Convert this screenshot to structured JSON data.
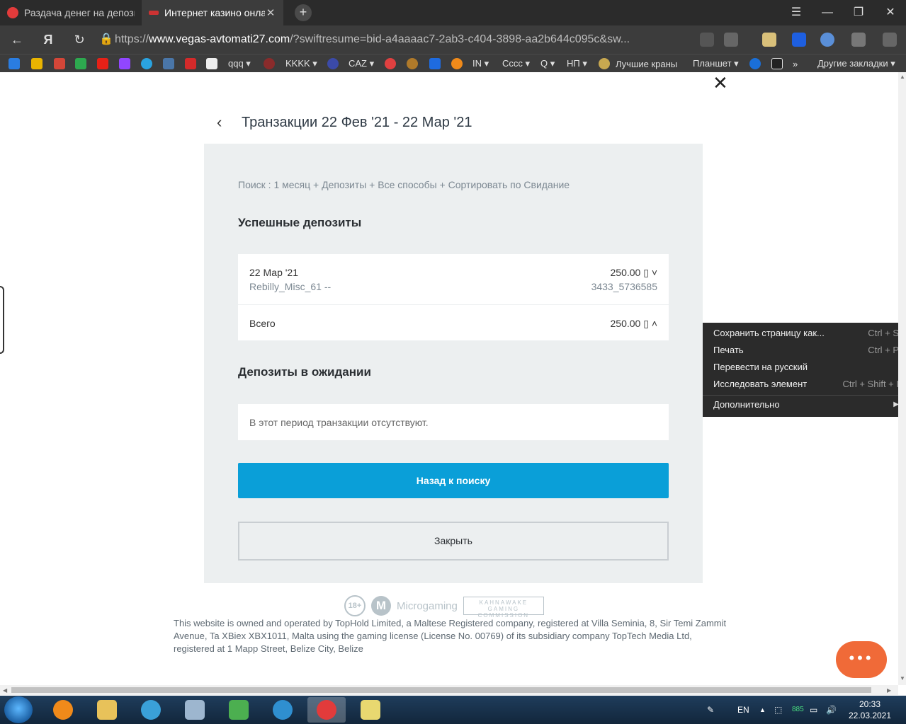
{
  "browser": {
    "tabs": [
      {
        "title": "Раздача денег на депозит",
        "active": false
      },
      {
        "title": "Интернет казино онлайн",
        "active": true
      }
    ],
    "new_tab": "+",
    "window_controls": [
      "☰",
      "—",
      "❐",
      "✕"
    ],
    "address": {
      "scheme": "https://",
      "host": "www.vegas-avtomati27.com",
      "path": "/?swiftresume=bid-a4aaaac7-2ab3-c404-3898-aa2b644c095c&sw..."
    },
    "bookmarks": [
      "qqq ▾",
      "KKKK ▾",
      "CAZ ▾",
      "IN ▾",
      "Cccc ▾",
      "Q ▾",
      "НП ▾",
      "Лучшие краны",
      "Планшет ▾",
      "»",
      "Другие закладки ▾"
    ]
  },
  "page": {
    "close_icon": "✕",
    "back_icon": "‹",
    "title": "Транзакции 22 Фев '21 - 22 Мар '21",
    "filter": "Поиск : 1 месяц + Депозиты + Все способы + Сортировать по Свидание",
    "successful": {
      "heading": "Успешные депозиты",
      "item": {
        "date": "22 Мар '21",
        "method": "Rebilly_Misc_61 --",
        "amount": "250.00 ▯ ˅",
        "reference": "3433_5736585"
      },
      "total_label": "Всего",
      "total_amount": "250.00 ▯ ˄"
    },
    "pending": {
      "heading": "Депозиты в ожидании",
      "empty": "В этот период транзакции отсутствуют."
    },
    "back_to_search": "Назад к поиску",
    "close_button": "Закрыть",
    "logos": {
      "age": "18+",
      "provider": "Microgaming",
      "commission": "KAHNAWAKE GAMING COMMISSION"
    },
    "legal": "This website is owned and operated by TopHold Limited, a Maltese Registered company, registered at Villa Seminia, 8, Sir Temi Zammit Avenue, Ta XBiex XBX1011, Malta using the gaming license (License No. 00769) of its subsidiary company TopTech Media Ltd, registered at 1 Mapp Street, Belize City, Belize",
    "chat_button": "•••"
  },
  "context_menu": [
    {
      "label": "Сохранить страницу как...",
      "shortcut": "Ctrl + S"
    },
    {
      "label": "Печать",
      "shortcut": "Ctrl + P"
    },
    {
      "label": "Перевести на русский",
      "shortcut": ""
    },
    {
      "label": "Исследовать элемент",
      "shortcut": "Ctrl + Shift + I"
    },
    {
      "label": "Дополнительно",
      "shortcut": "▶"
    }
  ],
  "taskbar": {
    "lang": "EN",
    "counter": "885",
    "time": "20:33",
    "date": "22.03.2021"
  }
}
